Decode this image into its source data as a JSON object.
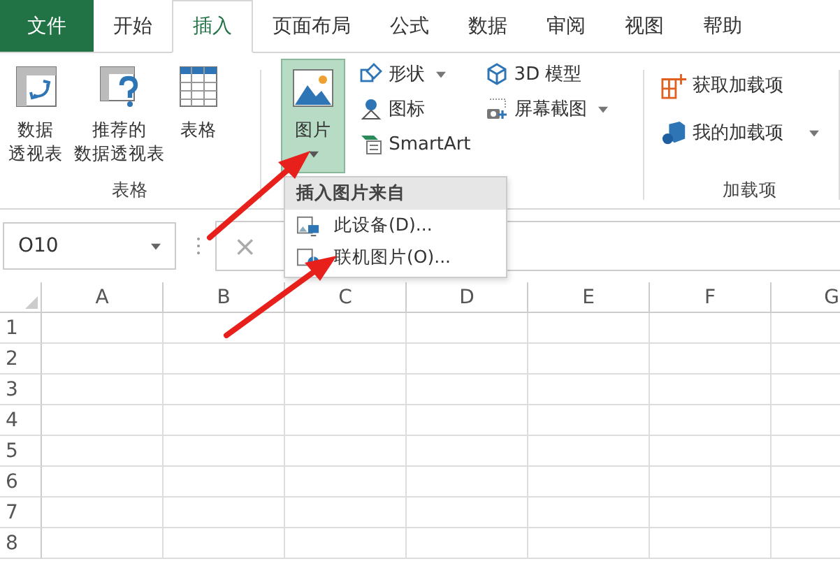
{
  "tabs": [
    {
      "label": "文件",
      "kind": "file",
      "selected": false
    },
    {
      "label": "开始",
      "kind": "tab",
      "selected": false
    },
    {
      "label": "插入",
      "kind": "tab",
      "selected": true
    },
    {
      "label": "页面布局",
      "kind": "tab",
      "selected": false
    },
    {
      "label": "公式",
      "kind": "tab",
      "selected": false
    },
    {
      "label": "数据",
      "kind": "tab",
      "selected": false
    },
    {
      "label": "审阅",
      "kind": "tab",
      "selected": false
    },
    {
      "label": "视图",
      "kind": "tab",
      "selected": false
    },
    {
      "label": "帮助",
      "kind": "tab",
      "selected": false
    }
  ],
  "tables_group": {
    "label": "表格",
    "buttons": [
      {
        "kind": "pivot",
        "lines": [
          "数据",
          "透视表"
        ]
      },
      {
        "kind": "recommended",
        "lines": [
          "推荐的",
          "数据透视表"
        ]
      },
      {
        "kind": "table",
        "lines": [
          "表格"
        ]
      }
    ]
  },
  "illustrations_group": {
    "picture": {
      "label": "图片",
      "selected": true
    },
    "column_1": [
      {
        "kind": "shapes",
        "label": "形状",
        "dropdown": true
      },
      {
        "kind": "icons",
        "label": "图标",
        "dropdown": false
      },
      {
        "kind": "smartart",
        "label": "SmartArt",
        "dropdown": false
      }
    ],
    "column_2": [
      {
        "kind": "model",
        "label": "3D 模型",
        "dropdown": false
      },
      {
        "kind": "screenshot",
        "label": "屏幕截图",
        "dropdown": true
      }
    ]
  },
  "addins_group": {
    "label": "加载项",
    "buttons": [
      {
        "kind": "get",
        "label": "获取加载项",
        "dropdown": false
      },
      {
        "kind": "mine",
        "label": "我的加载项",
        "dropdown": true
      }
    ]
  },
  "picture_menu": {
    "header": "插入图片来自",
    "items": [
      {
        "kind": "device",
        "label": "此设备(D)..."
      },
      {
        "kind": "online",
        "label": "联机图片(O)..."
      }
    ]
  },
  "formula_bar": {
    "name_box": "O10",
    "cancel": "×"
  },
  "sheet": {
    "columns": [
      "A",
      "B",
      "C",
      "D",
      "E",
      "F",
      "G"
    ],
    "rows": [
      "1",
      "2",
      "3",
      "4",
      "5",
      "6",
      "7",
      "8"
    ]
  }
}
